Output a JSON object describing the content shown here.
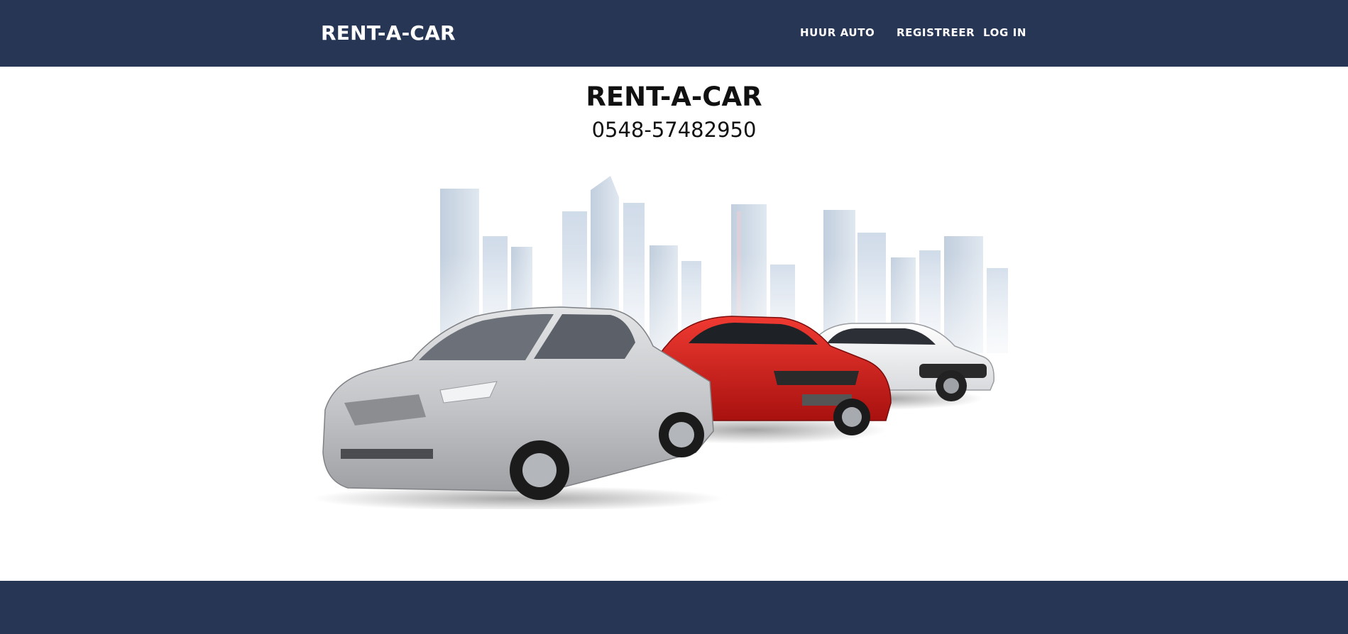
{
  "navbar": {
    "brand": "RENT-A-CAR",
    "links": [
      {
        "label": "HUUR AUTO"
      },
      {
        "label": "REGISTREER"
      },
      {
        "label": "LOG IN"
      }
    ]
  },
  "hero": {
    "title": "RENT-A-CAR",
    "phone": "0548-57482950"
  },
  "colors": {
    "navbar_bg": "#283655",
    "text_light": "#ffffff",
    "text_dark": "#111111",
    "car_silver": "#c6c8cb",
    "car_red": "#d41f1f",
    "car_white": "#f4f4f4"
  }
}
